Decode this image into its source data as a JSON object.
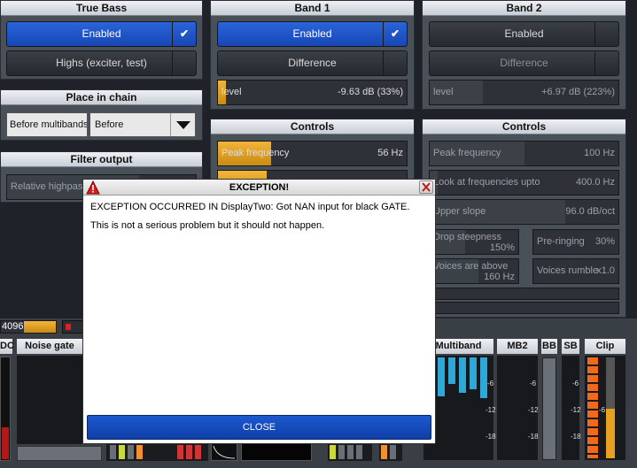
{
  "true_bass": {
    "title": "True Bass",
    "enabled_label": "Enabled",
    "highs_label": "Highs (exciter, test)"
  },
  "place_in_chain": {
    "title": "Place in chain",
    "label": "Before multibands",
    "value": "Before"
  },
  "filter_output": {
    "title": "Filter output",
    "label": "Relative highpass"
  },
  "band1": {
    "title": "Band 1",
    "enabled_label": "Enabled",
    "difference_label": "Difference",
    "level_label": "level",
    "level_value": "-9.63 dB (33%)"
  },
  "band2": {
    "title": "Band 2",
    "enabled_label": "Enabled",
    "difference_label": "Difference",
    "level_label": "level",
    "level_value": "+6.97 dB (223%)"
  },
  "controls1": {
    "title": "Controls",
    "peak_label": "Peak frequency",
    "peak_value": "56 Hz"
  },
  "controls2": {
    "title": "Controls",
    "peak_label": "Peak frequency",
    "peak_value": "100 Hz",
    "look_label": "Look at frequencies upto",
    "look_value": "400.0 Hz",
    "upper_label": "Upper slope",
    "upper_value": "96.0 dB/oct",
    "drop_label": "Drop steepness",
    "drop_value": "150%",
    "prering_label": "Pre-ringing",
    "prering_value": "30%",
    "voices_label": "Voices are above",
    "voices_value": "160 Hz",
    "rumble_label": "Voices rumble",
    "rumble_value": "x1.0"
  },
  "bottom": {
    "buffer_value": "4096",
    "noise_gate": "Noise gate",
    "dc": "DC",
    "multiband": "Multiband",
    "mb2": "MB2",
    "bb": "BB",
    "sb": "SB",
    "clip": "Clip",
    "tick_6": "-6",
    "tick_12": "-12",
    "tick_18": "-18"
  },
  "dialog": {
    "title": "EXCEPTION!",
    "line1": "EXCEPTION OCCURRED IN DisplayTwo: Got NAN input for black GATE.",
    "line2": "This is not a serious problem but it should not happen.",
    "close_label": "CLOSE"
  },
  "colors": {
    "accent_blue": "#1747b5",
    "slider_orange": "#e0a020",
    "panel_grey": "#4a5058",
    "meter_cyan": "#2fa8d8"
  }
}
